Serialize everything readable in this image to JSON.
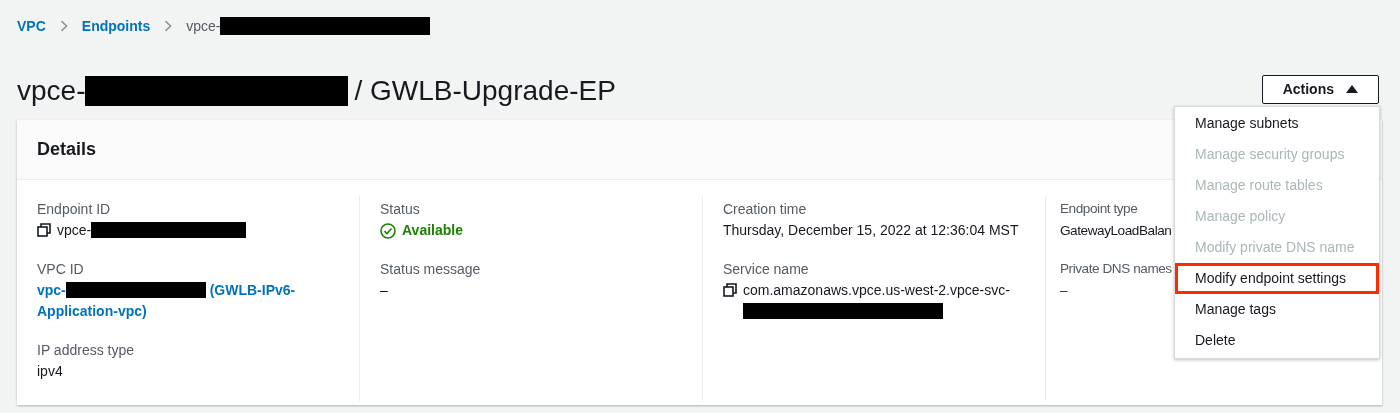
{
  "breadcrumbs": [
    {
      "label": "VPC",
      "kind": "link"
    },
    {
      "label": "Endpoints",
      "kind": "link"
    },
    {
      "label": "vpce-",
      "kind": "current",
      "redacted": true
    }
  ],
  "title": {
    "prefix": "vpce-",
    "redacted": true,
    "suffix": "/ GWLB-Upgrade-EP"
  },
  "actions": {
    "label": "Actions",
    "expanded": true,
    "items": [
      {
        "label": "Manage subnets",
        "disabled": false,
        "highlighted": false
      },
      {
        "label": "Manage security groups",
        "disabled": true,
        "highlighted": false
      },
      {
        "label": "Manage route tables",
        "disabled": true,
        "highlighted": false
      },
      {
        "label": "Manage policy",
        "disabled": true,
        "highlighted": false
      },
      {
        "label": "Modify private DNS name",
        "disabled": true,
        "highlighted": false
      },
      {
        "label": "Modify endpoint settings",
        "disabled": false,
        "highlighted": true
      },
      {
        "label": "Manage tags",
        "disabled": false,
        "highlighted": false
      },
      {
        "label": "Delete",
        "disabled": false,
        "highlighted": false
      }
    ]
  },
  "details": {
    "title": "Details",
    "columns": [
      [
        {
          "label": "Endpoint ID",
          "kind": "copy",
          "value": "vpce-",
          "redacted": true
        },
        {
          "label": "VPC ID",
          "kind": "link",
          "value": "vpc-",
          "redacted": true,
          "suffix": "(GWLB-IPv6-Application-vpc)"
        },
        {
          "label": "IP address type",
          "kind": "text",
          "value": "ipv4"
        }
      ],
      [
        {
          "label": "Status",
          "kind": "status",
          "value": "Available"
        },
        {
          "label": "Status message",
          "kind": "text",
          "value": "–"
        }
      ],
      [
        {
          "label": "Creation time",
          "kind": "text",
          "value": "Thursday, December 15, 2022 at 12:36:04 MST"
        },
        {
          "label": "Service name",
          "kind": "copy",
          "value": "com.amazonaws.vpce.us-west-2.vpce-svc-",
          "redacted": true
        }
      ],
      [
        {
          "label": "Endpoint type",
          "kind": "text",
          "value": "GatewayLoadBalan"
        },
        {
          "label": "Private DNS names",
          "kind": "text",
          "value": "–"
        }
      ]
    ]
  }
}
